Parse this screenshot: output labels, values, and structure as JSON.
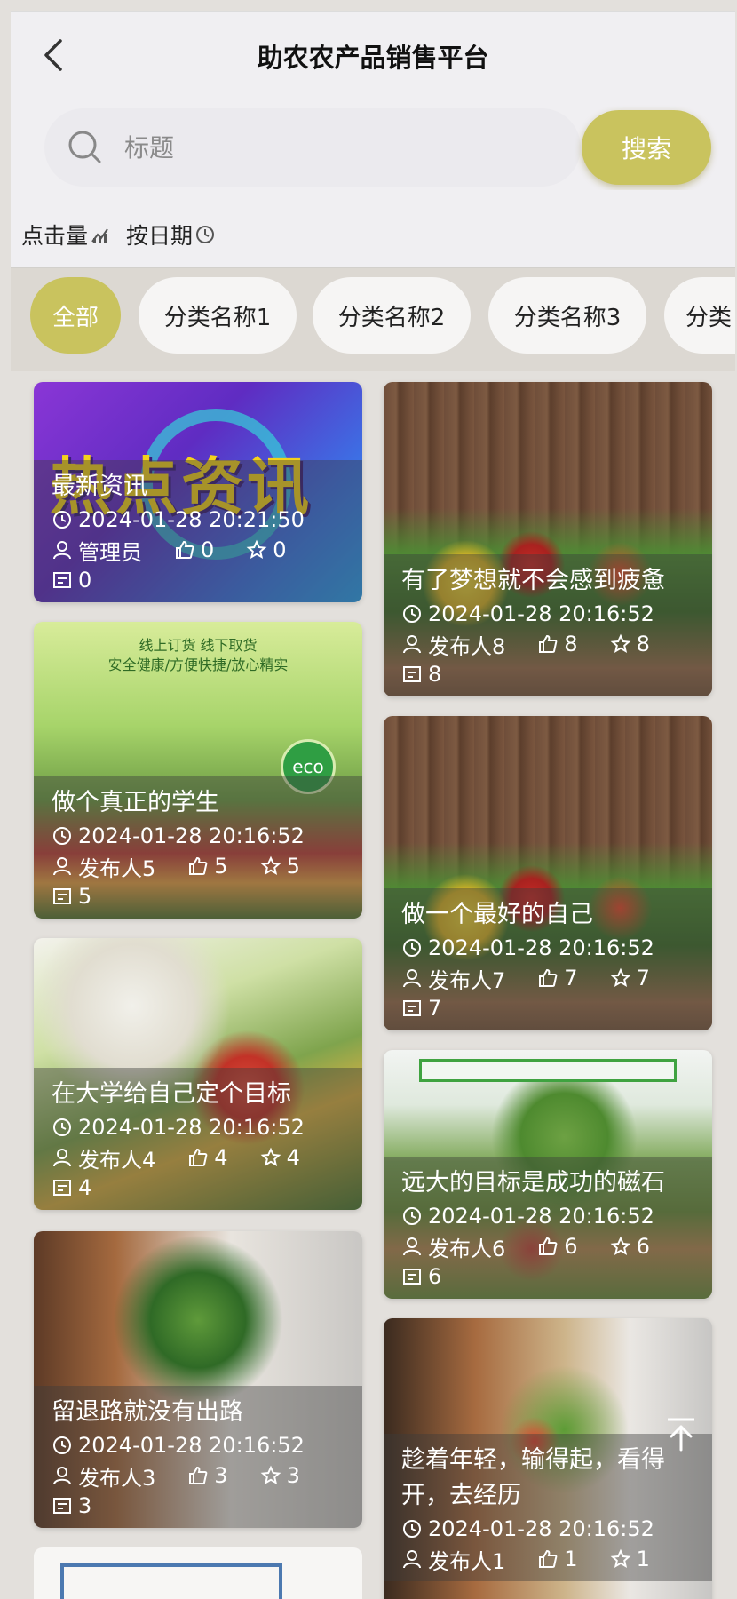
{
  "header": {
    "title": "助农农产品销售平台"
  },
  "search": {
    "placeholder": "标题",
    "button_label": "搜索"
  },
  "sort": {
    "by_clicks": "点击量",
    "by_date": "按日期"
  },
  "categories": [
    "全部",
    "分类名称1",
    "分类名称2",
    "分类名称3",
    "分类"
  ],
  "cards": [
    {
      "title": "最新资讯",
      "time": "2024-01-28 20:21:50",
      "author": "管理员",
      "likes": "0",
      "favorites": "0",
      "views": "0"
    },
    {
      "title": "有了梦想就不会感到疲惫",
      "time": "2024-01-28 20:16:52",
      "author": "发布人8",
      "likes": "8",
      "favorites": "8",
      "views": "8"
    },
    {
      "title": "做个真正的学生",
      "time": "2024-01-28 20:16:52",
      "author": "发布人5",
      "likes": "5",
      "favorites": "5",
      "views": "5"
    },
    {
      "title": "做一个最好的自己",
      "time": "2024-01-28 20:16:52",
      "author": "发布人7",
      "likes": "7",
      "favorites": "7",
      "views": "7"
    },
    {
      "title": "在大学给自己定个目标",
      "time": "2024-01-28 20:16:52",
      "author": "发布人4",
      "likes": "4",
      "favorites": "4",
      "views": "4"
    },
    {
      "title": "远大的目标是成功的磁石",
      "time": "2024-01-28 20:16:52",
      "author": "发布人6",
      "likes": "6",
      "favorites": "6",
      "views": "6"
    },
    {
      "title": "留退路就没有出路",
      "time": "2024-01-28 20:16:52",
      "author": "发布人3",
      "likes": "3",
      "favorites": "3",
      "views": "3"
    },
    {
      "title": "趁着年轻，输得起，看得开，去经历",
      "time": "2024-01-28 20:16:52",
      "author": "发布人1",
      "likes": "1",
      "favorites": "1"
    }
  ],
  "image_text": {
    "hot": "热点资讯",
    "green_line1": "线上订货 线下取货",
    "green_line2": "安全健康/方便快捷/放心精实",
    "eco": "eco"
  },
  "colors": {
    "accent": "#c9c35e",
    "background": "#e3e0dc",
    "overlay": "rgba(60,60,60,0.42)"
  }
}
